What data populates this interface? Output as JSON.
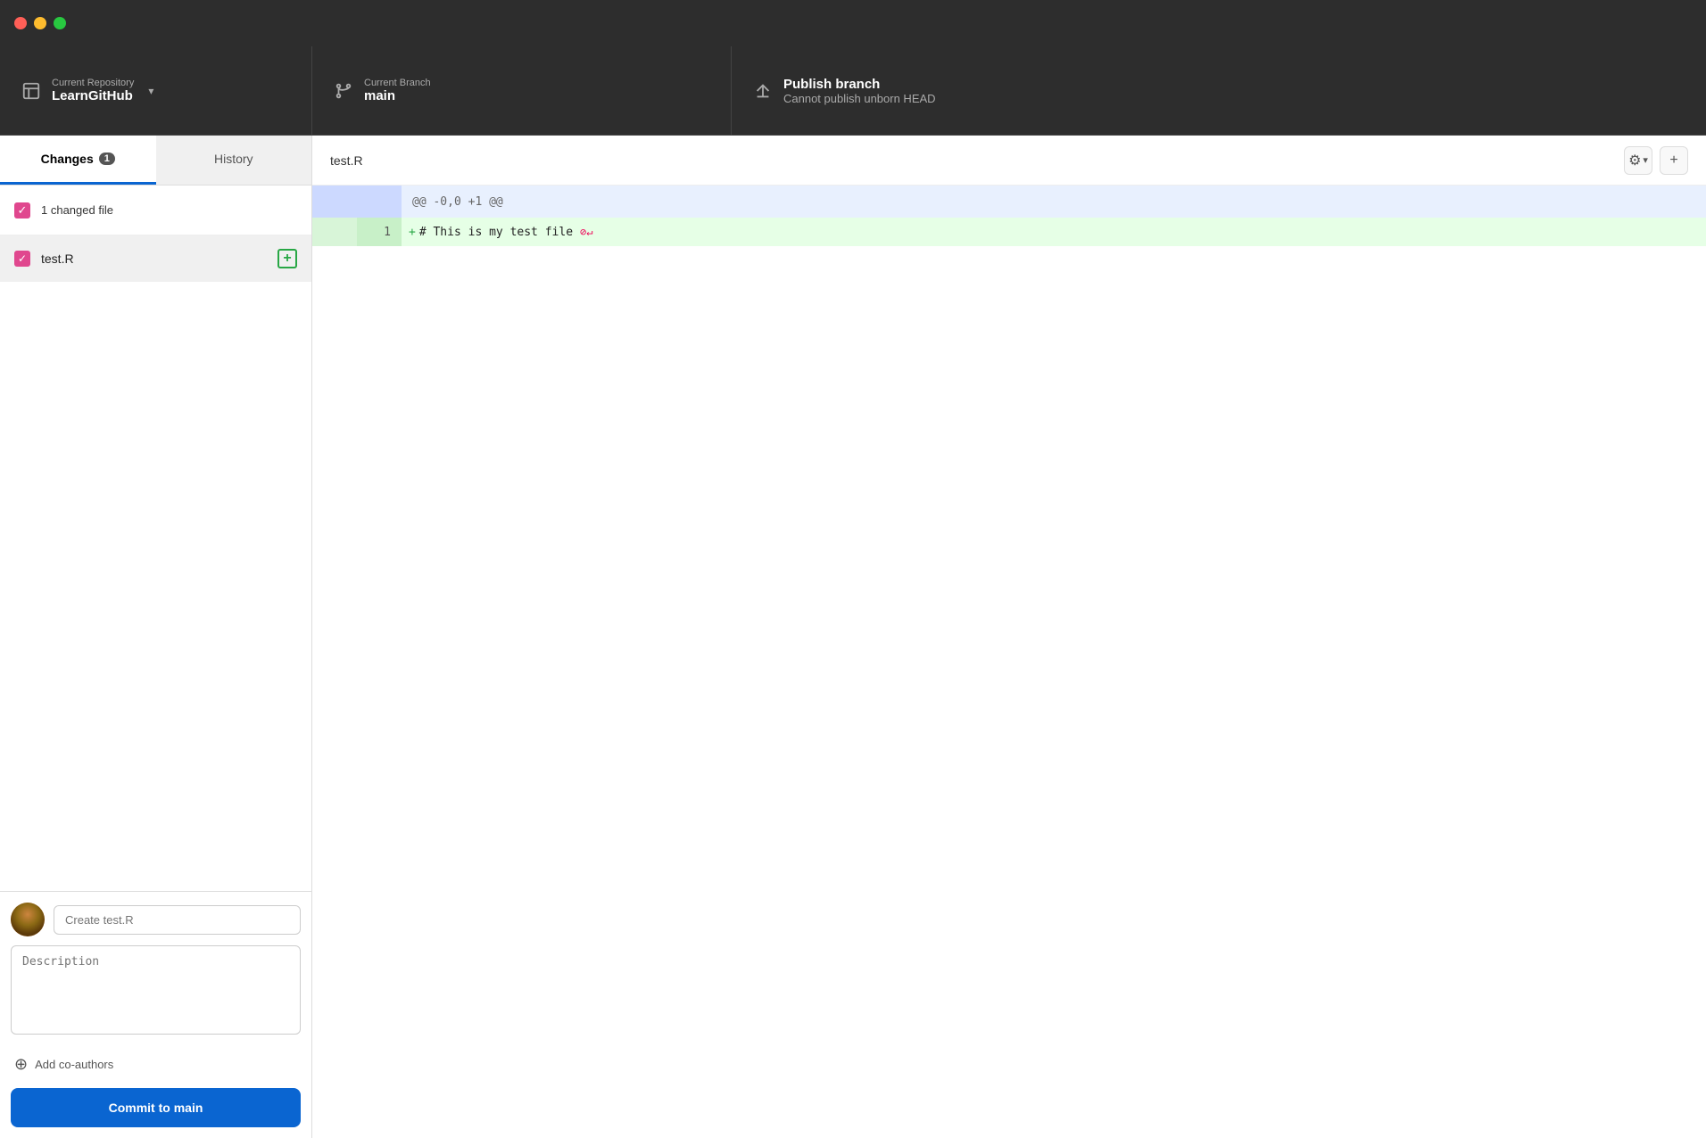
{
  "titlebar": {
    "traffic_lights": [
      "red",
      "yellow",
      "green"
    ]
  },
  "toolbar": {
    "repo_section": {
      "label": "Current Repository",
      "value": "LearnGitHub"
    },
    "branch_section": {
      "label": "Current Branch",
      "value": "main"
    },
    "publish_section": {
      "label": "Publish branch",
      "sublabel": "Cannot publish unborn HEAD"
    }
  },
  "left_panel": {
    "tabs": [
      {
        "id": "changes",
        "label": "Changes",
        "badge": "1",
        "active": true
      },
      {
        "id": "history",
        "label": "History",
        "badge": "",
        "active": false
      }
    ],
    "changed_files_header": "1 changed file",
    "files": [
      {
        "name": "test.R",
        "status": "added"
      }
    ],
    "commit": {
      "title_placeholder": "Create test.R",
      "description_placeholder": "Description",
      "co_author_label": "Add co-authors",
      "button_text_pre": "Commit to ",
      "button_branch": "main"
    }
  },
  "diff": {
    "filename": "test.R",
    "hunk_header": "@@ -0,0 +1 @@",
    "lines": [
      {
        "old_num": "",
        "new_num": "1",
        "prefix": "+",
        "content": "# This is my test file",
        "type": "added",
        "no_newline": true
      }
    ]
  },
  "icons": {
    "repo": "▤",
    "branch": "⑂",
    "publish": "↑",
    "dropdown": "▾",
    "gear": "⚙",
    "plus_square": "+",
    "checkmark": "✓",
    "co_author": "⊕",
    "no_newline": "⊘↵"
  }
}
